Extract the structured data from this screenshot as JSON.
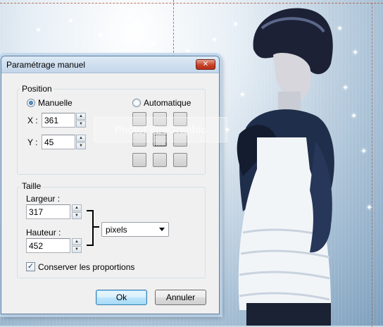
{
  "dialog": {
    "title": "Paramétrage manuel",
    "close_glyph": "✕",
    "position": {
      "group_label": "Position",
      "manual_label": "Manuelle",
      "auto_label": "Automatique",
      "x_label": "X :",
      "x_value": "361",
      "y_label": "Y :",
      "y_value": "45",
      "selected_mode": "Manuelle"
    },
    "size": {
      "group_label": "Taille",
      "width_label": "Largeur :",
      "width_value": "317",
      "height_label": "Hauteur :",
      "height_value": "452",
      "unit_value": "pixels",
      "keep_ratio_label": "Conserver les proportions",
      "keep_ratio_checked": true
    },
    "ok_label": "Ok",
    "cancel_label": "Annuler"
  },
  "watermark_text": "PhotoFiltreGraphic",
  "colors": {
    "titlebar": "#c4d6ea",
    "close_button": "#c7432a",
    "dialog_bg": "#f0f0f0"
  },
  "icons": {
    "close": "close-icon",
    "spin_up": "spin-up-icon",
    "spin_down": "spin-down-icon",
    "dropdown": "chevron-down-icon",
    "check": "checkmark-icon"
  }
}
